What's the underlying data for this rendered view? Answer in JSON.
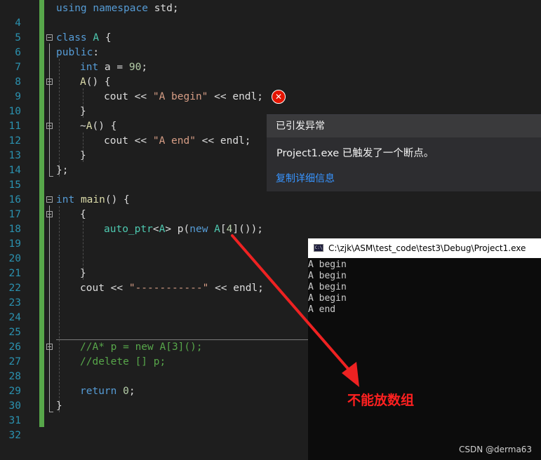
{
  "editor": {
    "line_numbers": [
      "4",
      "5",
      "6",
      "7",
      "8",
      "9",
      "10",
      "11",
      "12",
      "13",
      "14",
      "15",
      "16",
      "17",
      "18",
      "19",
      "20",
      "21",
      "22",
      "23",
      "24",
      "25",
      "26",
      "27",
      "28",
      "29",
      "30",
      "31",
      "32"
    ],
    "code": {
      "l4": {
        "a": "using",
        "b": " ",
        "c": "namespace",
        "d": " std;"
      },
      "l6": {
        "a": "class",
        "b": " ",
        "c": "A",
        "d": " {"
      },
      "l7": {
        "a": "public",
        "b": ":"
      },
      "l8": {
        "a": "int",
        "b": " a = ",
        "c": "90",
        "d": ";"
      },
      "l9": {
        "a": "A",
        "b": "() {"
      },
      "l10": {
        "a": "cout << ",
        "b": "\"A begin\"",
        "c": " << endl;"
      },
      "l11": {
        "a": "}"
      },
      "l12": {
        "a": "~",
        "b": "A",
        "c": "() {"
      },
      "l13": {
        "a": "cout << ",
        "b": "\"A end\"",
        "c": " << endl;"
      },
      "l14": {
        "a": "}"
      },
      "l15": {
        "a": "};"
      },
      "l17": {
        "a": "int",
        "b": " ",
        "c": "main",
        "d": "() {"
      },
      "l18": {
        "a": "{"
      },
      "l19": {
        "a": "auto_ptr",
        "b": "<",
        "c": "A",
        "d": "> p(",
        "e": "new",
        "f": " ",
        "g": "A",
        "h": "[",
        "i": "4",
        "j": "]());"
      },
      "l22": {
        "a": "}"
      },
      "l23": {
        "a": "cout << ",
        "b": "\"-----------\"",
        "c": " << endl;"
      },
      "l27": {
        "a": "//A* p = new A[3]();"
      },
      "l28": {
        "a": "//delete [] p;"
      },
      "l30": {
        "a": "return",
        "b": " ",
        "c": "0",
        "d": ";"
      },
      "l31": {
        "a": "}"
      }
    }
  },
  "exception_popup": {
    "title": "已引发异常",
    "message": "Project1.exe 已触发了一个断点。",
    "link": "复制详细信息"
  },
  "console": {
    "icon_label": "C:\\",
    "title": "C:\\zjk\\ASM\\test_code\\test3\\Debug\\Project1.exe",
    "output": [
      "A begin",
      "A begin",
      "A begin",
      "A begin",
      "A end"
    ]
  },
  "annotation": {
    "text": "不能放数组",
    "color": "#ff2020"
  },
  "watermark": "CSDN @derma63",
  "colors": {
    "background": "#1e1e1e",
    "keyword": "#569cd6",
    "type": "#4ec9b0",
    "function": "#dcdcaa",
    "string": "#d69d85",
    "number": "#b5cea8",
    "comment": "#57a64a",
    "line_number": "#2b91af",
    "link": "#3794ff",
    "error": "#e51400"
  }
}
